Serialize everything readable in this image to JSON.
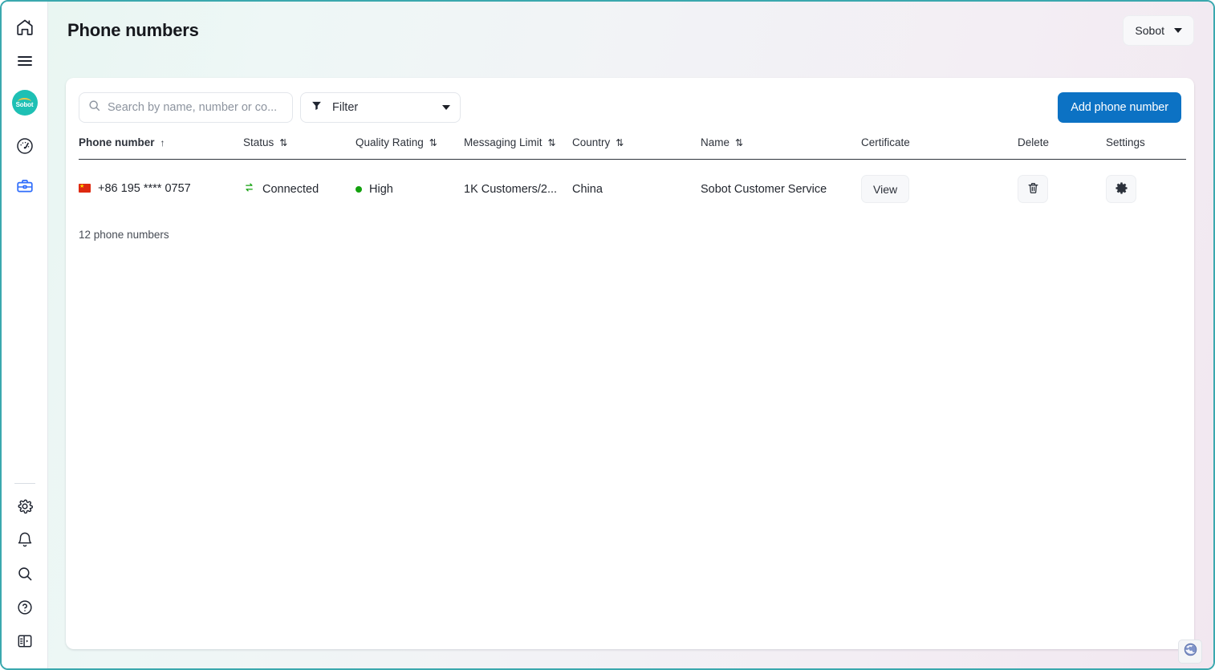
{
  "sidebar": {
    "items": [
      {
        "name": "home-icon",
        "label": "Home"
      },
      {
        "name": "menu-icon",
        "label": "Menu"
      },
      {
        "name": "sobot-logo",
        "label": "Sobot"
      },
      {
        "name": "dashboard-icon",
        "label": "Dashboard"
      },
      {
        "name": "briefcase-icon",
        "label": "Workspace"
      }
    ],
    "logo_text": "Sobot",
    "bottom_items": [
      {
        "name": "gear-icon",
        "label": "Settings"
      },
      {
        "name": "bell-icon",
        "label": "Notifications"
      },
      {
        "name": "search-icon",
        "label": "Search"
      },
      {
        "name": "help-icon",
        "label": "Help"
      },
      {
        "name": "panel-toggle-icon",
        "label": "Toggle panel"
      }
    ]
  },
  "header": {
    "title": "Phone numbers",
    "account": "Sobot"
  },
  "toolbar": {
    "search_placeholder": "Search by name, number or co...",
    "search_value": "",
    "filter_label": "Filter",
    "add_button": "Add phone number"
  },
  "table": {
    "columns": [
      {
        "key": "phone_number",
        "label": "Phone number",
        "sortable": true,
        "sorted": true,
        "sort_glyph": "↑"
      },
      {
        "key": "status",
        "label": "Status",
        "sortable": true,
        "sorted": false,
        "sort_glyph": "⇅"
      },
      {
        "key": "quality_rating",
        "label": "Quality Rating",
        "sortable": true,
        "sorted": false,
        "sort_glyph": "⇅"
      },
      {
        "key": "messaging_limit",
        "label": "Messaging Limit",
        "sortable": true,
        "sorted": false,
        "sort_glyph": "⇅"
      },
      {
        "key": "country",
        "label": "Country",
        "sortable": true,
        "sorted": false,
        "sort_glyph": "⇅"
      },
      {
        "key": "name",
        "label": "Name",
        "sortable": true,
        "sorted": false,
        "sort_glyph": "⇅"
      },
      {
        "key": "certificate",
        "label": "Certificate",
        "sortable": false,
        "sorted": false,
        "sort_glyph": ""
      },
      {
        "key": "delete",
        "label": "Delete",
        "sortable": false,
        "sorted": false,
        "sort_glyph": ""
      },
      {
        "key": "settings",
        "label": "Settings",
        "sortable": false,
        "sorted": false,
        "sort_glyph": ""
      }
    ],
    "rows": [
      {
        "flag": "cn-flag-icon",
        "phone_number": "+86 195 **** 0757",
        "status": "Connected",
        "status_icon": "connected-arrows-icon",
        "status_color": "#13a10e",
        "quality_rating": "High",
        "quality_color": "#13a10e",
        "messaging_limit": "1K Customers/2...",
        "country": "China",
        "name": "Sobot Customer Service",
        "certificate_button": "View",
        "delete_icon": "trash-icon",
        "settings_icon": "gear-icon"
      }
    ],
    "footer_count": "12 phone numbers"
  },
  "footer": {
    "language_icon": "globe-icon"
  },
  "colors": {
    "accent_blue": "#0c72c4",
    "brand_teal": "#1ec0b4",
    "status_green": "#13a10e",
    "frame_teal": "#3aa8ae",
    "flag_red": "#de2910"
  }
}
